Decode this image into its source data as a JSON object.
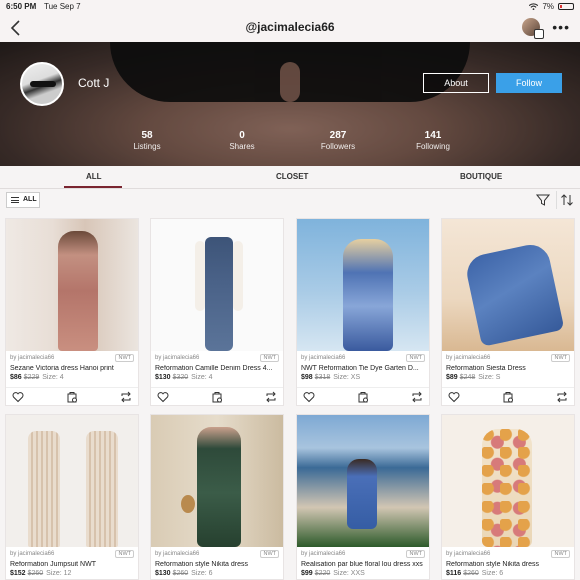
{
  "status": {
    "time": "6:50 PM",
    "date": "Tue Sep 7",
    "battery": "7%"
  },
  "nav": {
    "title": "@jacimalecia66"
  },
  "profile": {
    "name": "Cott J",
    "about_label": "About",
    "follow_label": "Follow",
    "stats": [
      {
        "value": "58",
        "label": "Listings"
      },
      {
        "value": "0",
        "label": "Shares"
      },
      {
        "value": "287",
        "label": "Followers"
      },
      {
        "value": "141",
        "label": "Following"
      }
    ]
  },
  "tabs": [
    {
      "label": "ALL",
      "active": true
    },
    {
      "label": "CLOSET",
      "active": false
    },
    {
      "label": "BOUTIQUE",
      "active": false
    }
  ],
  "filter": {
    "all_label": "ALL"
  },
  "colors": {
    "accent": "#7a2430",
    "follow": "#3aa0e8"
  },
  "listings": [
    {
      "seller": "by jacimalecia66",
      "badge": "NWT",
      "title": "Sezane Victoria dress Hanoi print",
      "price": "$86",
      "original": "$229",
      "size": "Size: 4"
    },
    {
      "seller": "by jacimalecia66",
      "badge": "NWT",
      "title": "Reformation Camille Denim Dress 4...",
      "price": "$130",
      "original": "$320",
      "size": "Size: 4"
    },
    {
      "seller": "by jacimalecia66",
      "badge": "NWT",
      "title": "NWT Reformation Tie Dye Garten D...",
      "price": "$98",
      "original": "$318",
      "size": "Size: XS"
    },
    {
      "seller": "by jacimalecia66",
      "badge": "NWT",
      "title": "Reformation Siesta Dress",
      "price": "$89",
      "original": "$248",
      "size": "Size: S"
    },
    {
      "seller": "by jacimalecia66",
      "badge": "NWT",
      "title": "Reformation Jumpsuit NWT",
      "price": "$152",
      "original": "$260",
      "size": "Size: 12"
    },
    {
      "seller": "by jacimalecia66",
      "badge": "NWT",
      "title": "Reformation style Nikita dress",
      "price": "$130",
      "original": "$260",
      "size": "Size: 6"
    },
    {
      "seller": "by jacimalecia66",
      "badge": "NWT",
      "title": "Realisation par blue floral lou dress xxs",
      "price": "$99",
      "original": "$220",
      "size": "Size: XXS"
    },
    {
      "seller": "by jacimalecia66",
      "badge": "NWT",
      "title": "Reformation style Nikita dress",
      "price": "$116",
      "original": "$260",
      "size": "Size: 6"
    }
  ]
}
